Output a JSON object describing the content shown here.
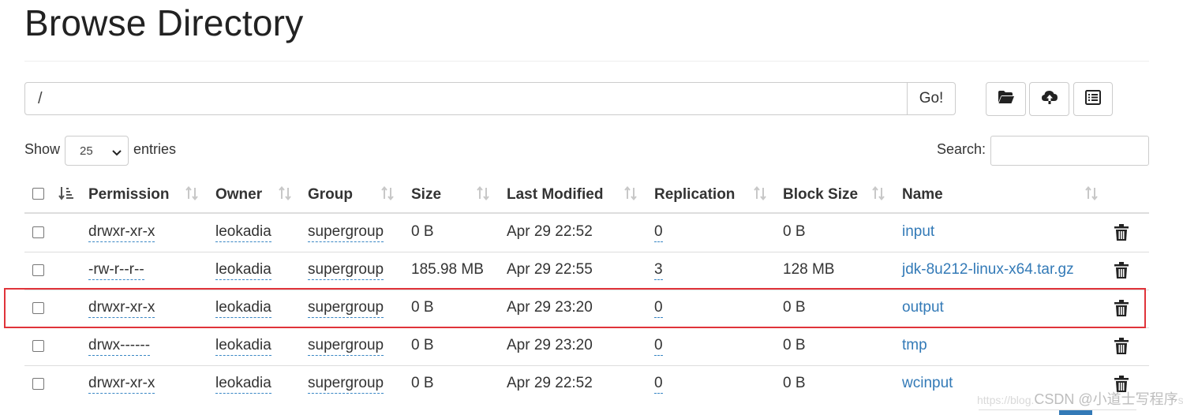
{
  "page": {
    "title": "Browse Directory"
  },
  "path_bar": {
    "value": "/",
    "go_label": "Go!"
  },
  "toolbar": {
    "icons": [
      "folder-open-icon",
      "cloud-upload-icon",
      "list-alt-icon"
    ]
  },
  "show": {
    "label": "Show",
    "selected": "25",
    "suffix": "entries"
  },
  "search": {
    "label": "Search:",
    "value": ""
  },
  "table": {
    "columns": [
      "Permission",
      "Owner",
      "Group",
      "Size",
      "Last Modified",
      "Replication",
      "Block Size",
      "Name"
    ],
    "rows": [
      {
        "permission": "drwxr-xr-x",
        "owner": "leokadia",
        "group": "supergroup",
        "size": "0 B",
        "modified": "Apr 29 22:52",
        "replication": "0",
        "block_size": "0 B",
        "name": "input"
      },
      {
        "permission": "-rw-r--r--",
        "owner": "leokadia",
        "group": "supergroup",
        "size": "185.98 MB",
        "modified": "Apr 29 22:55",
        "replication": "3",
        "block_size": "128 MB",
        "name": "jdk-8u212-linux-x64.tar.gz"
      },
      {
        "permission": "drwxr-xr-x",
        "owner": "leokadia",
        "group": "supergroup",
        "size": "0 B",
        "modified": "Apr 29 23:20",
        "replication": "0",
        "block_size": "0 B",
        "name": "output",
        "highlighted": true
      },
      {
        "permission": "drwx------",
        "owner": "leokadia",
        "group": "supergroup",
        "size": "0 B",
        "modified": "Apr 29 23:20",
        "replication": "0",
        "block_size": "0 B",
        "name": "tmp"
      },
      {
        "permission": "drwxr-xr-x",
        "owner": "leokadia",
        "group": "supergroup",
        "size": "0 B",
        "modified": "Apr 29 22:52",
        "replication": "0",
        "block_size": "0 B",
        "name": "wcinput"
      }
    ]
  },
  "colors": {
    "link": "#337ab7",
    "highlight": "#e0343a"
  },
  "watermark": {
    "text": "CSDN @小道士写程序",
    "prefix": "https://blog.",
    "suffix": "ss"
  }
}
